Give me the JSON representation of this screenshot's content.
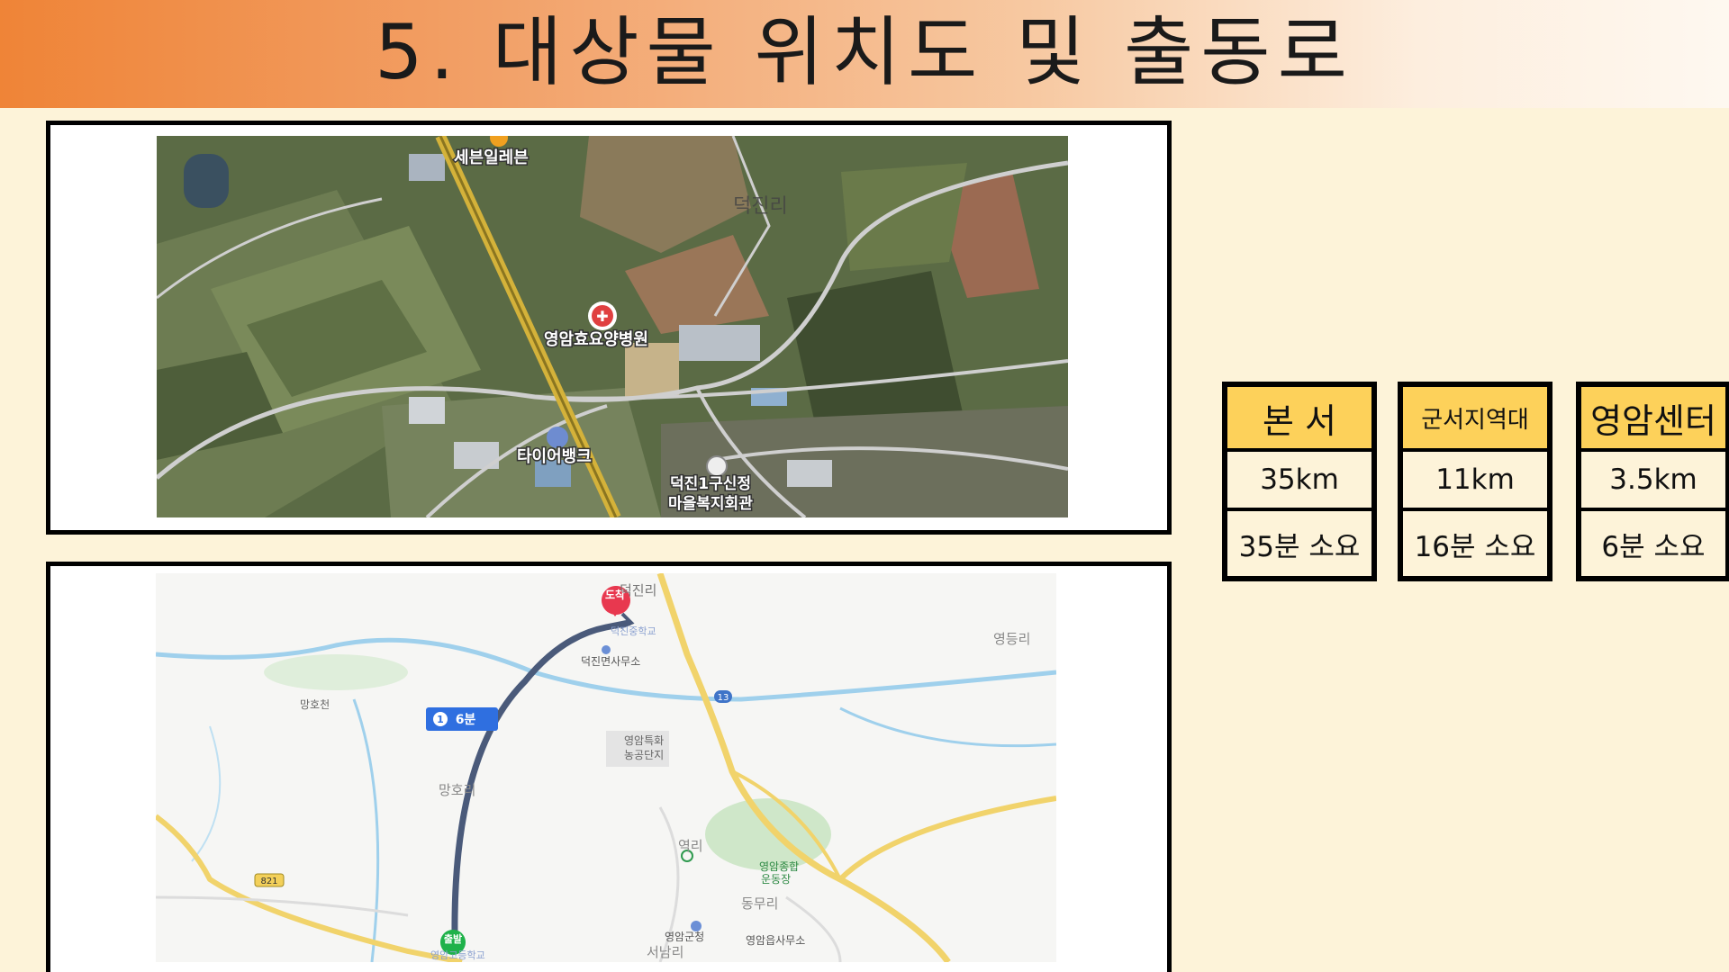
{
  "slide": {
    "title": "5. 대상물 위치도 및 출동로"
  },
  "satellite_map": {
    "labels": {
      "seven_eleven": "세븐일레븐",
      "village": "덕진리",
      "hospital": "영암효요양병원",
      "tire_bank": "타이어뱅크",
      "welfare_line1": "덕진1구신정",
      "welfare_line2": "마을복지회관"
    }
  },
  "route_map": {
    "arrival_badge": "도착",
    "departure_badge": "출발",
    "route_badge_number": "1",
    "route_badge_time": "6분",
    "road_number_13": "13",
    "road_number_821": "821",
    "labels": {
      "deokjin_ri": "덕진리",
      "school_top": "덕진중학교",
      "office": "덕진면사무소",
      "yeongdeung_ri": "영등리",
      "manghoncheon": "망호천",
      "industrial_line1": "영암특화",
      "industrial_line2": "농공단지",
      "mangho_ri": "망호리",
      "yeok_ri": "역리",
      "stadium_line1": "영암종합",
      "stadium_line2": "운동장",
      "dongmu_ri": "동무리",
      "county_office": "영암군청",
      "seonam_ri": "서남리",
      "eup_office": "영암읍사무소",
      "high_school": "영암고등학교"
    }
  },
  "dispatch_routes": [
    {
      "name": "본 서",
      "distance": "35km",
      "time": "35분 소요"
    },
    {
      "name": "군서지역대",
      "distance": "11km",
      "time": "16분 소요"
    },
    {
      "name": "영암센터",
      "distance": "3.5km",
      "time": "6분 소요"
    }
  ],
  "colors": {
    "background": "#fdf3d9",
    "header_start": "#ef8437",
    "box_header": "#fdd15a",
    "route_line": "#4a5a7a",
    "arrival_pin": "#e8384f",
    "departure_pin": "#1fb24a",
    "route_badge": "#2f6fe0"
  }
}
